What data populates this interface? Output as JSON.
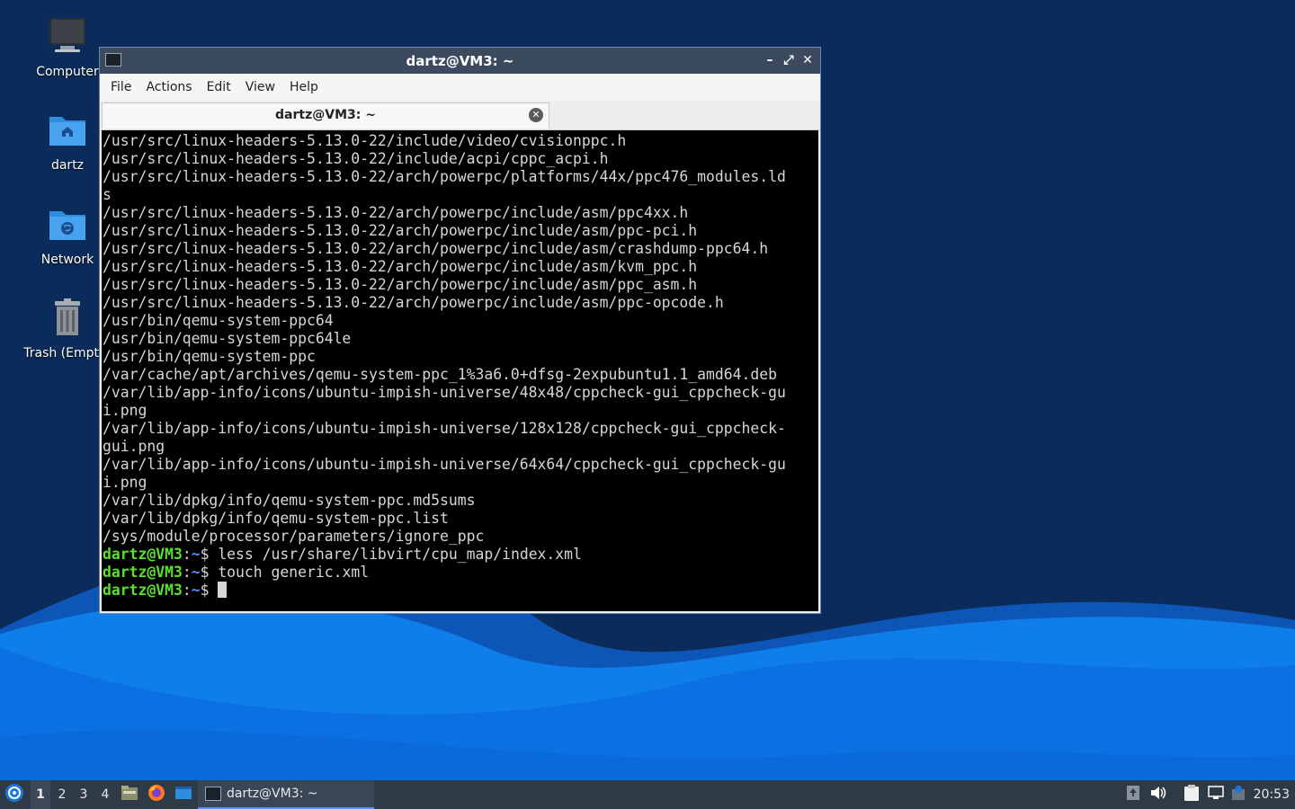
{
  "desktop": {
    "icons": [
      {
        "label": "Computer",
        "icon": "computer-icon"
      },
      {
        "label": "dartz",
        "icon": "home-folder-icon"
      },
      {
        "label": "Network",
        "icon": "network-folder-icon"
      },
      {
        "label": "Trash (Empty)",
        "icon": "trash-icon"
      }
    ]
  },
  "window": {
    "title": "dartz@VM3: ~",
    "minimize_label": "–",
    "maximize_label": "⤢",
    "close_label": "✕"
  },
  "menubar": {
    "items": [
      "File",
      "Actions",
      "Edit",
      "View",
      "Help"
    ]
  },
  "tab": {
    "label": "dartz@VM3: ~",
    "close_label": "✕"
  },
  "terminal": {
    "output": [
      "/usr/src/linux-headers-5.13.0-22/include/video/cvisionppc.h",
      "/usr/src/linux-headers-5.13.0-22/include/acpi/cppc_acpi.h",
      "/usr/src/linux-headers-5.13.0-22/arch/powerpc/platforms/44x/ppc476_modules.ld",
      "s",
      "/usr/src/linux-headers-5.13.0-22/arch/powerpc/include/asm/ppc4xx.h",
      "/usr/src/linux-headers-5.13.0-22/arch/powerpc/include/asm/ppc-pci.h",
      "/usr/src/linux-headers-5.13.0-22/arch/powerpc/include/asm/crashdump-ppc64.h",
      "/usr/src/linux-headers-5.13.0-22/arch/powerpc/include/asm/kvm_ppc.h",
      "/usr/src/linux-headers-5.13.0-22/arch/powerpc/include/asm/ppc_asm.h",
      "/usr/src/linux-headers-5.13.0-22/arch/powerpc/include/asm/ppc-opcode.h",
      "/usr/bin/qemu-system-ppc64",
      "/usr/bin/qemu-system-ppc64le",
      "/usr/bin/qemu-system-ppc",
      "/var/cache/apt/archives/qemu-system-ppc_1%3a6.0+dfsg-2expubuntu1.1_amd64.deb",
      "/var/lib/app-info/icons/ubuntu-impish-universe/48x48/cppcheck-gui_cppcheck-gu",
      "i.png",
      "/var/lib/app-info/icons/ubuntu-impish-universe/128x128/cppcheck-gui_cppcheck-",
      "gui.png",
      "/var/lib/app-info/icons/ubuntu-impish-universe/64x64/cppcheck-gui_cppcheck-gu",
      "i.png",
      "/var/lib/dpkg/info/qemu-system-ppc.md5sums",
      "/var/lib/dpkg/info/qemu-system-ppc.list",
      "/sys/module/processor/parameters/ignore_ppc"
    ],
    "prompts": [
      {
        "user": "dartz@VM3",
        "sep": ":",
        "path": "~",
        "symbol": "$ ",
        "command": "less /usr/share/libvirt/cpu_map/index.xml"
      },
      {
        "user": "dartz@VM3",
        "sep": ":",
        "path": "~",
        "symbol": "$ ",
        "command": "touch generic.xml"
      },
      {
        "user": "dartz@VM3",
        "sep": ":",
        "path": "~",
        "symbol": "$ ",
        "command": ""
      }
    ]
  },
  "taskbar": {
    "workspaces": [
      "1",
      "2",
      "3",
      "4"
    ],
    "active_workspace": "1",
    "launchers": [
      "file-manager-icon",
      "firefox-icon",
      "show-desktop-icon"
    ],
    "task_label": "dartz@VM3: ~",
    "tray_icons": [
      "upload-icon",
      "volume-icon",
      "clipboard-icon",
      "network-icon",
      "update-notifier-icon"
    ],
    "clock": "20:53"
  },
  "colors": {
    "prompt_user": "#5ce02f",
    "prompt_path": "#5b8ef0",
    "terminal_bg": "#000000",
    "terminal_fg": "#d6d6d6",
    "taskbar_bg": "#2f3a47"
  }
}
